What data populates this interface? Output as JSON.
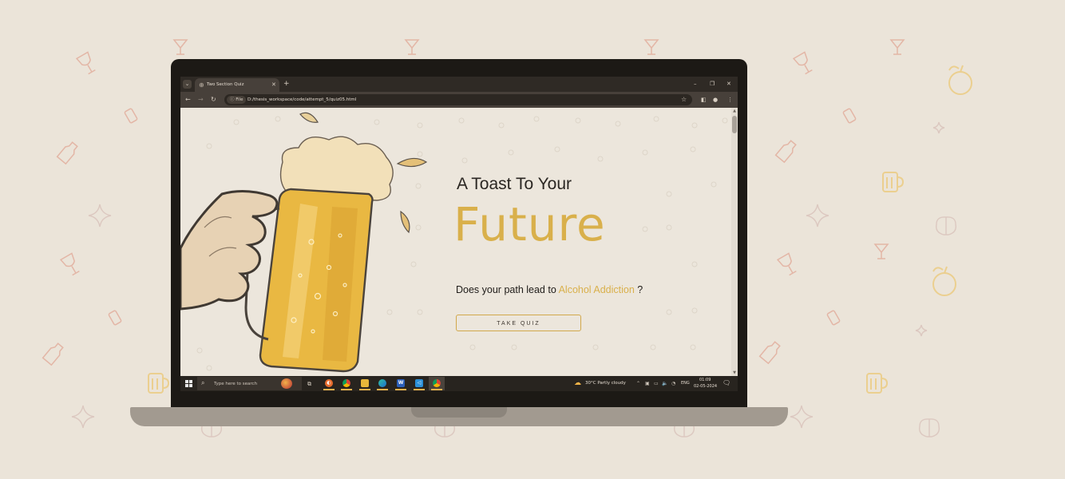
{
  "browser": {
    "tab_title": "Two Section Quiz",
    "site_chip": "File",
    "url": "D:/thesis_workspace/code/attempt_5/quiz05.html",
    "icons": {
      "tab_search": "chevron-down-icon",
      "favicon": "globe-icon",
      "tab_close": "close-icon",
      "new_tab": "plus-icon",
      "minimize": "minimize-icon",
      "restore": "restore-icon",
      "close": "close-icon",
      "back": "back-arrow-icon",
      "forward": "forward-arrow-icon",
      "reload": "reload-icon",
      "info": "info-icon",
      "bookmark": "star-icon",
      "side_panel": "side-panel-icon",
      "profile": "profile-icon",
      "menu": "kebab-menu-icon"
    }
  },
  "page": {
    "heading_line1": "A Toast To Your",
    "heading_line2": "Future",
    "question_prefix": "Does your path lead to",
    "question_highlight": "Alcohol Addiction",
    "question_suffix": "?",
    "cta_label": "TAKE QUIZ",
    "accent_color": "#d9b04b",
    "background_color": "#ece6dc",
    "illustration": "hand-holding-beer-mug"
  },
  "taskbar": {
    "search_placeholder": "Type here to search",
    "apps": [
      "firefox",
      "chrome",
      "file-explorer",
      "edge",
      "word",
      "vscode",
      "chrome"
    ],
    "weather": "30°C  Partly cloudy",
    "language": "ENG",
    "time": "01:09",
    "date": "02-05-2024"
  }
}
